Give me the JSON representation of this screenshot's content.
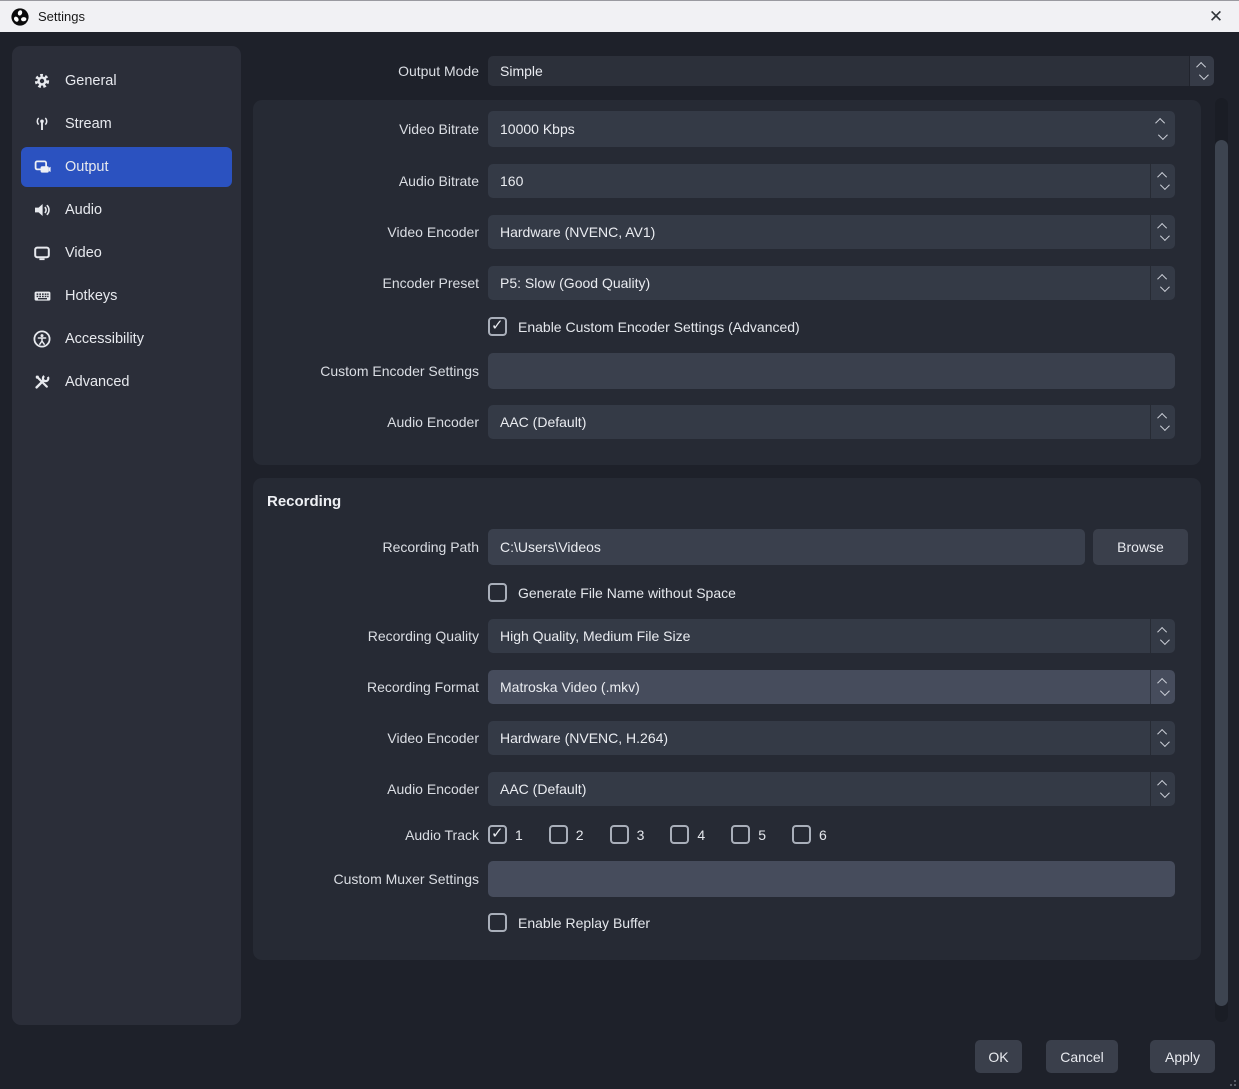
{
  "window": {
    "title": "Settings"
  },
  "sidebar": {
    "selected_color": "#2b52c0",
    "items": [
      {
        "label": "General",
        "icon": "gear-icon",
        "selected": false
      },
      {
        "label": "Stream",
        "icon": "broadcast-icon",
        "selected": false
      },
      {
        "label": "Output",
        "icon": "output-icon",
        "selected": true
      },
      {
        "label": "Audio",
        "icon": "speaker-icon",
        "selected": false
      },
      {
        "label": "Video",
        "icon": "monitor-icon",
        "selected": false
      },
      {
        "label": "Hotkeys",
        "icon": "keyboard-icon",
        "selected": false
      },
      {
        "label": "Accessibility",
        "icon": "accessibility-icon",
        "selected": false
      },
      {
        "label": "Advanced",
        "icon": "tools-icon",
        "selected": false
      }
    ]
  },
  "output_mode": {
    "label": "Output Mode",
    "value": "Simple"
  },
  "streaming": {
    "video_bitrate": {
      "label": "Video Bitrate",
      "value": "10000 Kbps"
    },
    "audio_bitrate": {
      "label": "Audio Bitrate",
      "value": "160"
    },
    "video_encoder": {
      "label": "Video Encoder",
      "value": "Hardware (NVENC, AV1)"
    },
    "encoder_preset": {
      "label": "Encoder Preset",
      "value": "P5: Slow (Good Quality)"
    },
    "enable_custom_encoder": {
      "label": "Enable Custom Encoder Settings (Advanced)",
      "checked": true
    },
    "custom_encoder_settings": {
      "label": "Custom Encoder Settings",
      "value": ""
    },
    "audio_encoder": {
      "label": "Audio Encoder",
      "value": "AAC (Default)"
    }
  },
  "recording": {
    "header": "Recording",
    "recording_path": {
      "label": "Recording Path",
      "value": "C:\\Users\\Videos",
      "browse_label": "Browse"
    },
    "generate_no_space": {
      "label": "Generate File Name without Space",
      "checked": false
    },
    "recording_quality": {
      "label": "Recording Quality",
      "value": "High Quality, Medium File Size"
    },
    "recording_format": {
      "label": "Recording Format",
      "value": "Matroska Video (.mkv)"
    },
    "video_encoder": {
      "label": "Video Encoder",
      "value": "Hardware (NVENC, H.264)"
    },
    "audio_encoder": {
      "label": "Audio Encoder",
      "value": "AAC (Default)"
    },
    "audio_track": {
      "label": "Audio Track",
      "tracks": [
        {
          "label": "1",
          "checked": true
        },
        {
          "label": "2",
          "checked": false
        },
        {
          "label": "3",
          "checked": false
        },
        {
          "label": "4",
          "checked": false
        },
        {
          "label": "5",
          "checked": false
        },
        {
          "label": "6",
          "checked": false
        }
      ]
    },
    "custom_muxer_settings": {
      "label": "Custom Muxer Settings",
      "value": ""
    },
    "enable_replay_buffer": {
      "label": "Enable Replay Buffer",
      "checked": false
    }
  },
  "footer": {
    "ok": "OK",
    "cancel": "Cancel",
    "apply": "Apply"
  },
  "colors": {
    "accent": "#2b52c0",
    "titlebar": "#f1f1f4",
    "window_bg": "#1e212a",
    "panel_bg": "#262a34",
    "field_bg": "#343a46"
  }
}
